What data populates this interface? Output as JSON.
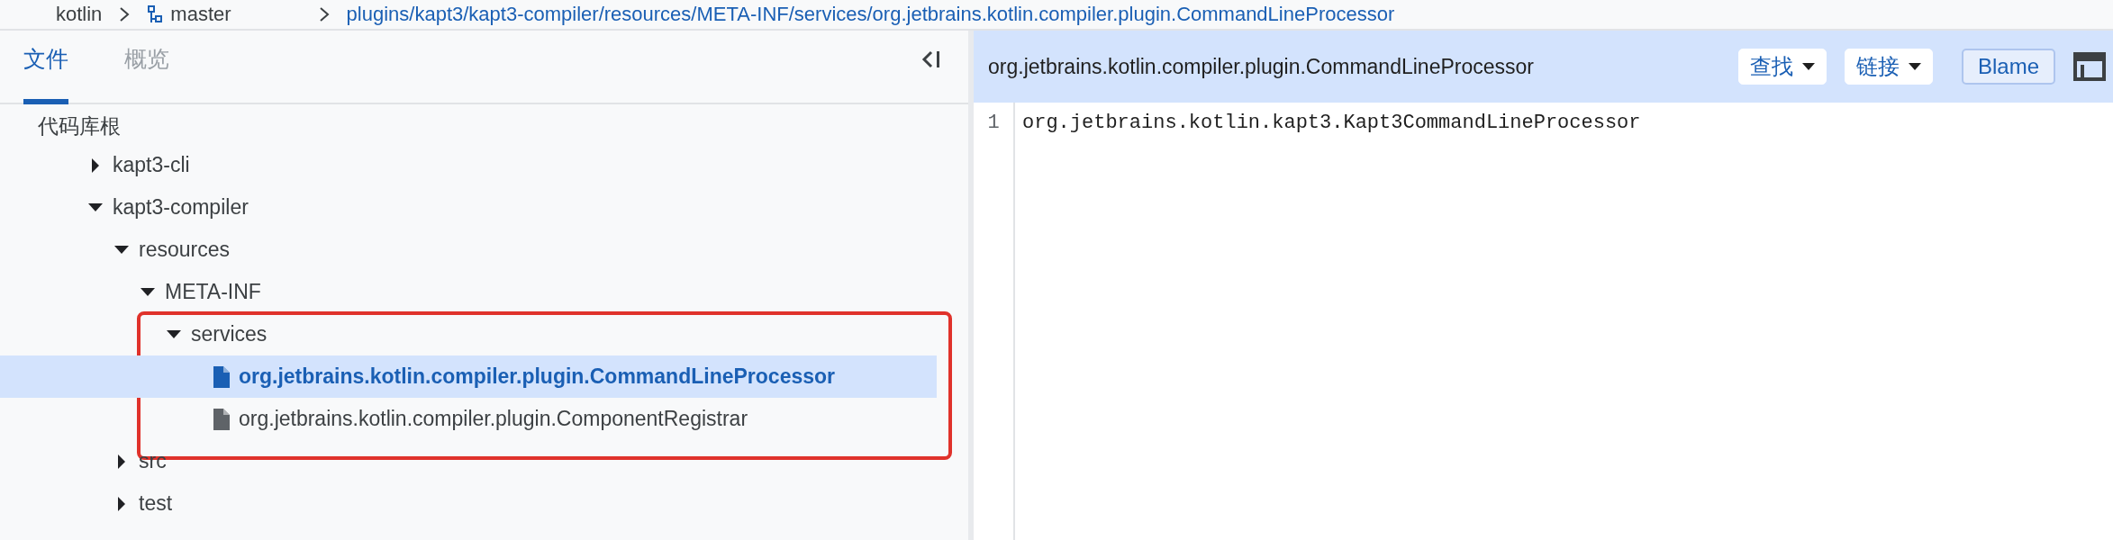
{
  "breadcrumb": [
    {
      "label": "kotlin",
      "kind": "repo"
    },
    {
      "label": "master",
      "kind": "branch"
    },
    {
      "label": "plugins/kapt3/kapt3-compiler/resources/META-INF/services/org.jetbrains.kotlin.compiler.plugin.CommandLineProcessor",
      "kind": "path"
    }
  ],
  "tabs": [
    {
      "label": "文件",
      "selected": true
    },
    {
      "label": "概览",
      "selected": false
    }
  ],
  "tree": {
    "root_label": "代码库根",
    "items": [
      {
        "label": "kapt3-cli",
        "kind": "folder",
        "expanded": false,
        "selected": false
      },
      {
        "label": "kapt3-compiler",
        "kind": "folder",
        "expanded": true,
        "selected": false,
        "children": [
          {
            "label": "resources",
            "kind": "folder",
            "expanded": true,
            "selected": false,
            "children": [
              {
                "label": "META-INF",
                "kind": "folder",
                "expanded": true,
                "selected": false,
                "children": [
                  {
                    "label": "services",
                    "kind": "folder",
                    "expanded": true,
                    "selected": false,
                    "highlight_box": true,
                    "children": [
                      {
                        "label": "org.jetbrains.kotlin.compiler.plugin.CommandLineProcessor",
                        "kind": "file",
                        "selected": true
                      },
                      {
                        "label": "org.jetbrains.kotlin.compiler.plugin.ComponentRegistrar",
                        "kind": "file",
                        "selected": false
                      }
                    ]
                  }
                ]
              }
            ]
          },
          {
            "label": "src",
            "kind": "folder",
            "expanded": false,
            "selected": false
          },
          {
            "label": "test",
            "kind": "folder",
            "expanded": false,
            "selected": false
          }
        ]
      }
    ]
  },
  "file_view": {
    "title": "org.jetbrains.kotlin.compiler.plugin.CommandLineProcessor",
    "actions": [
      {
        "label": "查找",
        "kind": "dropdown"
      },
      {
        "label": "链接",
        "kind": "dropdown"
      },
      {
        "label": "Blame",
        "kind": "toggle"
      }
    ],
    "lines": [
      {
        "number": "1",
        "text": "org.jetbrains.kotlin.kapt3.Kapt3CommandLineProcessor"
      }
    ]
  }
}
